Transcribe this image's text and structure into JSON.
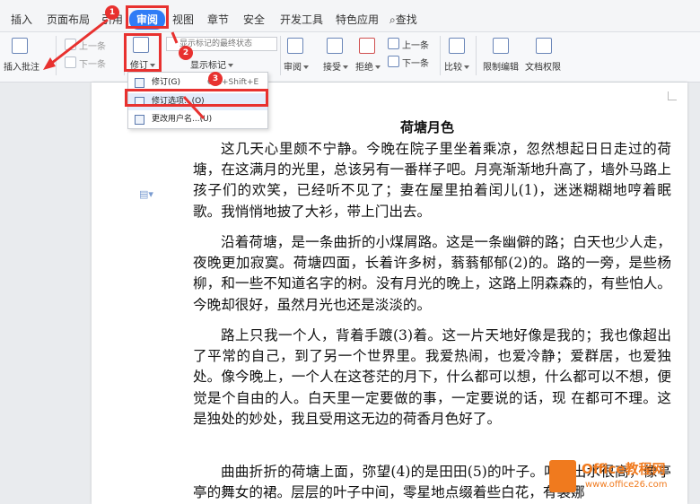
{
  "tabs": [
    "插入",
    "页面布局",
    "引用",
    "审阅",
    "视图",
    "章节",
    "安全",
    "开发工具",
    "特色应用",
    "查找"
  ],
  "ribbon": {
    "insert_comment": "插入批注",
    "prev": "上一条",
    "next": "下一条",
    "revise": "修订",
    "display_state": "显示标记的最终状态",
    "show_markup": "显示标记",
    "review": "审阅",
    "accept": "接受",
    "reject": "拒绝",
    "prev2": "上一条",
    "next2": "下一条",
    "compare": "比较",
    "restrict_edit": "限制编辑",
    "doc_permission": "文档权限"
  },
  "menu": {
    "item1": "修订(G)",
    "shortcut": "Ctrl+Shift+E",
    "item2": "修订选项...(O)",
    "item3": "更改用户名...(U)"
  },
  "badges": [
    "1",
    "2",
    "3"
  ],
  "doc": {
    "title": "荷塘月色",
    "paragraphs": [
      "这几天心里颇不宁静。今晚在院子里坐着乘凉，忽然想起日日走过的荷塘，在这满月的光里，总该另有一番样子吧。月亮渐渐地升高了，墙外马路上孩子们的欢笑，已经听不见了；妻在屋里拍着闰儿(1)，迷迷糊糊地哼着眠歌。我悄悄地披了大衫，带上门出去。",
      "沿着荷塘，是一条曲折的小煤屑路。这是一条幽僻的路；白天也少人走，夜晚更加寂寞。荷塘四面，长着许多树，蓊蓊郁郁(2)的。路的一旁，是些杨柳，和一些不知道名字的树。没有月光的晚上，这路上阴森森的，有些怕人。今晚却很好，虽然月光也还是淡淡的。",
      "路上只我一个人，背着手踱(3)着。这一片天地好像是我的；我也像超出了平常的自己，到了另一个世界里。我爱热闹，也爱冷静；爱群居，也爱独处。像今晚上，一个人在这苍茫的月下，什么都可以想，什么都可以不想，便觉是个自由的人。白天里一定要做的事，一定要说的话，现 在都可不理。这是独处的妙处，我且受用这无边的荷香月色好了。",
      "曲曲折折的荷塘上面，弥望(4)的是田田(5)的叶子。叶子出水很高，像亭亭的舞女的裙。层层的叶子中间，零星地点缀着些白花，有袅娜"
    ]
  },
  "watermark": {
    "brand": "Office教程网",
    "url": "www.office26.com"
  }
}
